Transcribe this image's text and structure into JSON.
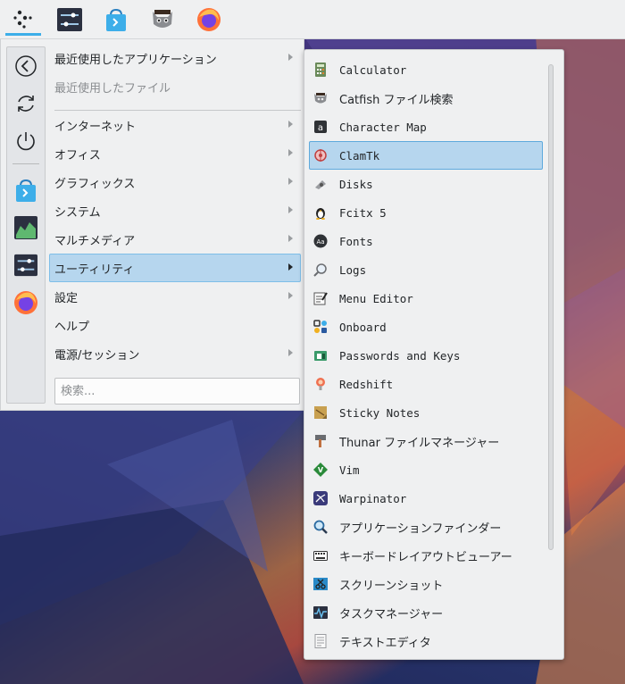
{
  "panel": {
    "buttons": [
      {
        "name": "application-launcher",
        "icon": "launcher-dots-icon"
      },
      {
        "name": "settings-manager",
        "icon": "sliders-icon"
      },
      {
        "name": "software-store",
        "icon": "store-bag-icon"
      },
      {
        "name": "catfish-search",
        "icon": "cat-icon"
      },
      {
        "name": "firefox",
        "icon": "firefox-icon"
      }
    ]
  },
  "sidebar": {
    "items": [
      {
        "icon": "back-arrow-icon"
      },
      {
        "icon": "refresh-icon"
      },
      {
        "icon": "power-icon"
      },
      {
        "icon": "store-bag-icon"
      },
      {
        "icon": "system-monitor-icon"
      },
      {
        "icon": "sliders-icon"
      },
      {
        "icon": "firefox-icon"
      }
    ]
  },
  "categories": [
    {
      "label": "最近使用したアプリケーション",
      "submenu": true
    },
    {
      "label": "最近使用したファイル",
      "submenu": false,
      "disabled": true
    },
    {
      "label": "インターネット",
      "submenu": true
    },
    {
      "label": "オフィス",
      "submenu": true
    },
    {
      "label": "グラフィックス",
      "submenu": true
    },
    {
      "label": "システム",
      "submenu": true
    },
    {
      "label": "マルチメディア",
      "submenu": true
    },
    {
      "label": "ユーティリティ",
      "submenu": true,
      "selected": true
    },
    {
      "label": "設定",
      "submenu": true
    },
    {
      "label": "ヘルプ",
      "submenu": false
    },
    {
      "label": "電源/セッション",
      "submenu": true
    }
  ],
  "search": {
    "placeholder": "検索..."
  },
  "apps": [
    {
      "label": "Calculator",
      "icon": "calculator-icon"
    },
    {
      "label": "Catfish ファイル検索",
      "icon": "catfish-icon"
    },
    {
      "label": "Character Map",
      "icon": "character-map-icon"
    },
    {
      "label": "ClamTk",
      "icon": "clamtk-icon",
      "selected": true
    },
    {
      "label": "Disks",
      "icon": "disks-icon"
    },
    {
      "label": "Fcitx 5",
      "icon": "penguin-icon"
    },
    {
      "label": "Fonts",
      "icon": "fonts-icon"
    },
    {
      "label": "Logs",
      "icon": "logs-icon"
    },
    {
      "label": "Menu Editor",
      "icon": "menu-editor-icon"
    },
    {
      "label": "Onboard",
      "icon": "onboard-icon"
    },
    {
      "label": "Passwords and Keys",
      "icon": "passwords-icon"
    },
    {
      "label": "Redshift",
      "icon": "redshift-icon"
    },
    {
      "label": "Sticky Notes",
      "icon": "sticky-notes-icon"
    },
    {
      "label": "Thunar ファイルマネージャー",
      "icon": "thunar-icon"
    },
    {
      "label": "Vim",
      "icon": "vim-icon"
    },
    {
      "label": "Warpinator",
      "icon": "warpinator-icon"
    },
    {
      "label": "アプリケーションファインダー",
      "icon": "app-finder-icon"
    },
    {
      "label": "キーボードレイアウトビューアー",
      "icon": "keyboard-icon"
    },
    {
      "label": "スクリーンショット",
      "icon": "screenshot-icon"
    },
    {
      "label": "タスクマネージャー",
      "icon": "task-manager-icon"
    },
    {
      "label": "テキストエディタ",
      "icon": "text-editor-icon"
    }
  ],
  "colors": {
    "accent": "#3daee9",
    "selection": "#b6d6ee"
  }
}
